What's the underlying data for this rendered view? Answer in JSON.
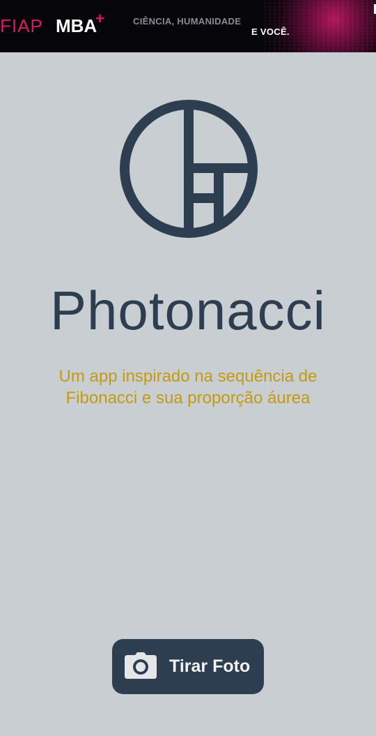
{
  "banner": {
    "brand_fiap": "FIAP",
    "brand_mba": "MBA",
    "brand_plus": "+",
    "tagline_line1": "CIÊNCIA, HUMANIDADE",
    "tagline_line2": "E VOCÊ."
  },
  "app": {
    "logo_icon": "fibonacci-spiral-logo",
    "title": "Photonacci",
    "subtitle": "Um app inspirado na sequência de Fibonacci e sua proporção áurea"
  },
  "actions": {
    "take_photo_label": "Tirar Foto",
    "take_photo_icon": "camera-icon"
  },
  "colors": {
    "background": "#c9ced2",
    "primary": "#2c3e50",
    "accent_gold": "#c49a10",
    "banner_pink": "#d81b60"
  }
}
